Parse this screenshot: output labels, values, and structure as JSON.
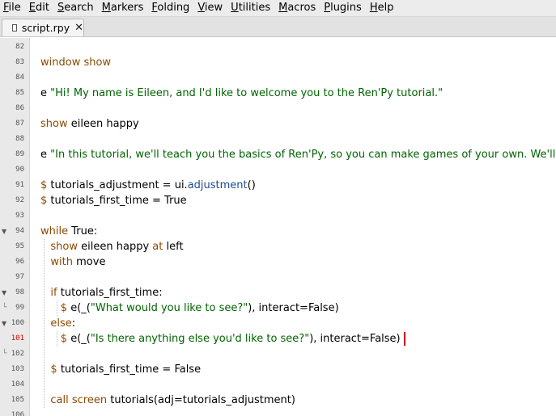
{
  "menubar": {
    "items": [
      {
        "label": "File",
        "key": "F",
        "rest": "ile"
      },
      {
        "label": "Edit",
        "key": "E",
        "rest": "dit"
      },
      {
        "label": "Search",
        "key": "S",
        "rest": "earch"
      },
      {
        "label": "Markers",
        "key": "M",
        "rest": "arkers"
      },
      {
        "label": "Folding",
        "key": "F",
        "rest": "olding"
      },
      {
        "label": "View",
        "key": "V",
        "rest": "iew"
      },
      {
        "label": "Utilities",
        "key": "U",
        "rest": "tilities"
      },
      {
        "label": "Macros",
        "key": "M",
        "rest": "acros"
      },
      {
        "label": "Plugins",
        "key": "P",
        "rest": "lugins"
      },
      {
        "label": "Help",
        "key": "H",
        "rest": "elp"
      }
    ]
  },
  "tab": {
    "filename": "script.rpy",
    "close_glyph": "✕"
  },
  "editor": {
    "current_line": "101",
    "lines": [
      {
        "n": "82",
        "fold": "",
        "tokens": []
      },
      {
        "n": "83",
        "fold": "",
        "tokens": [
          {
            "t": "window show",
            "c": "kw"
          }
        ]
      },
      {
        "n": "84",
        "fold": "",
        "tokens": []
      },
      {
        "n": "85",
        "fold": "",
        "tokens": [
          {
            "t": "e ",
            "c": ""
          },
          {
            "t": "\"Hi! My name is Eileen, and I'd like to welcome you to the Ren'Py tutorial.\"",
            "c": "str"
          }
        ]
      },
      {
        "n": "86",
        "fold": "",
        "tokens": []
      },
      {
        "n": "87",
        "fold": "",
        "tokens": [
          {
            "t": "show",
            "c": "kw"
          },
          {
            "t": " eileen happy",
            "c": ""
          }
        ]
      },
      {
        "n": "88",
        "fold": "",
        "tokens": []
      },
      {
        "n": "89",
        "fold": "",
        "tokens": [
          {
            "t": "e ",
            "c": ""
          },
          {
            "t": "\"In this tutorial, we'll teach you the basics of Ren'Py, so you can make games of your own. We'll also",
            "c": "str"
          }
        ]
      },
      {
        "n": "90",
        "fold": "",
        "tokens": []
      },
      {
        "n": "91",
        "fold": "",
        "tokens": [
          {
            "t": "$",
            "c": "kw"
          },
          {
            "t": " tutorials_adjustment = ui.",
            "c": ""
          },
          {
            "t": "adjustment",
            "c": "fn"
          },
          {
            "t": "()",
            "c": ""
          }
        ]
      },
      {
        "n": "92",
        "fold": "",
        "tokens": [
          {
            "t": "$",
            "c": "kw"
          },
          {
            "t": " tutorials_first_time = True",
            "c": ""
          }
        ]
      },
      {
        "n": "93",
        "fold": "",
        "tokens": []
      },
      {
        "n": "94",
        "fold": "open",
        "tokens": [
          {
            "t": "while",
            "c": "kw"
          },
          {
            "t": " True:",
            "c": ""
          }
        ]
      },
      {
        "n": "95",
        "fold": "",
        "tokens": [
          {
            "t": "   ",
            "c": ""
          },
          {
            "t": "show",
            "c": "kw"
          },
          {
            "t": " eileen happy ",
            "c": ""
          },
          {
            "t": "at",
            "c": "kw"
          },
          {
            "t": " left",
            "c": ""
          }
        ]
      },
      {
        "n": "96",
        "fold": "",
        "tokens": [
          {
            "t": "   ",
            "c": ""
          },
          {
            "t": "with",
            "c": "kw"
          },
          {
            "t": " move",
            "c": ""
          }
        ]
      },
      {
        "n": "97",
        "fold": "",
        "tokens": []
      },
      {
        "n": "98",
        "fold": "open",
        "tokens": [
          {
            "t": "   ",
            "c": ""
          },
          {
            "t": "if",
            "c": "kw"
          },
          {
            "t": " tutorials_first_time:",
            "c": ""
          }
        ]
      },
      {
        "n": "99",
        "fold": "end",
        "tokens": [
          {
            "t": "      ",
            "c": ""
          },
          {
            "t": "$",
            "c": "kw"
          },
          {
            "t": " e(_(",
            "c": ""
          },
          {
            "t": "\"What would you like to see?\"",
            "c": "str"
          },
          {
            "t": "), interact=False)",
            "c": ""
          }
        ]
      },
      {
        "n": "100",
        "fold": "open",
        "tokens": [
          {
            "t": "   ",
            "c": ""
          },
          {
            "t": "else",
            "c": "kw"
          },
          {
            "t": ":",
            "c": ""
          }
        ]
      },
      {
        "n": "101",
        "fold": "",
        "tokens": [
          {
            "t": "      ",
            "c": ""
          },
          {
            "t": "$",
            "c": "kw"
          },
          {
            "t": " e(_(",
            "c": ""
          },
          {
            "t": "\"Is there anything else you'd like to see?\"",
            "c": "str"
          },
          {
            "t": "), interact=False)",
            "c": ""
          }
        ]
      },
      {
        "n": "102",
        "fold": "end",
        "tokens": []
      },
      {
        "n": "103",
        "fold": "",
        "tokens": [
          {
            "t": "   ",
            "c": ""
          },
          {
            "t": "$",
            "c": "kw"
          },
          {
            "t": " tutorials_first_time = False",
            "c": ""
          }
        ]
      },
      {
        "n": "104",
        "fold": "",
        "tokens": []
      },
      {
        "n": "105",
        "fold": "",
        "tokens": [
          {
            "t": "   ",
            "c": ""
          },
          {
            "t": "call",
            "c": "kw"
          },
          {
            "t": " ",
            "c": ""
          },
          {
            "t": "screen",
            "c": "kw"
          },
          {
            "t": " tutorials(adj=tutorials_adjustment)",
            "c": ""
          }
        ]
      },
      {
        "n": "106",
        "fold": "",
        "tokens": []
      }
    ]
  },
  "colors": {
    "keyword": "#8b4a00",
    "string": "#006400",
    "function": "#1e4a94",
    "caret": "#d40000"
  }
}
